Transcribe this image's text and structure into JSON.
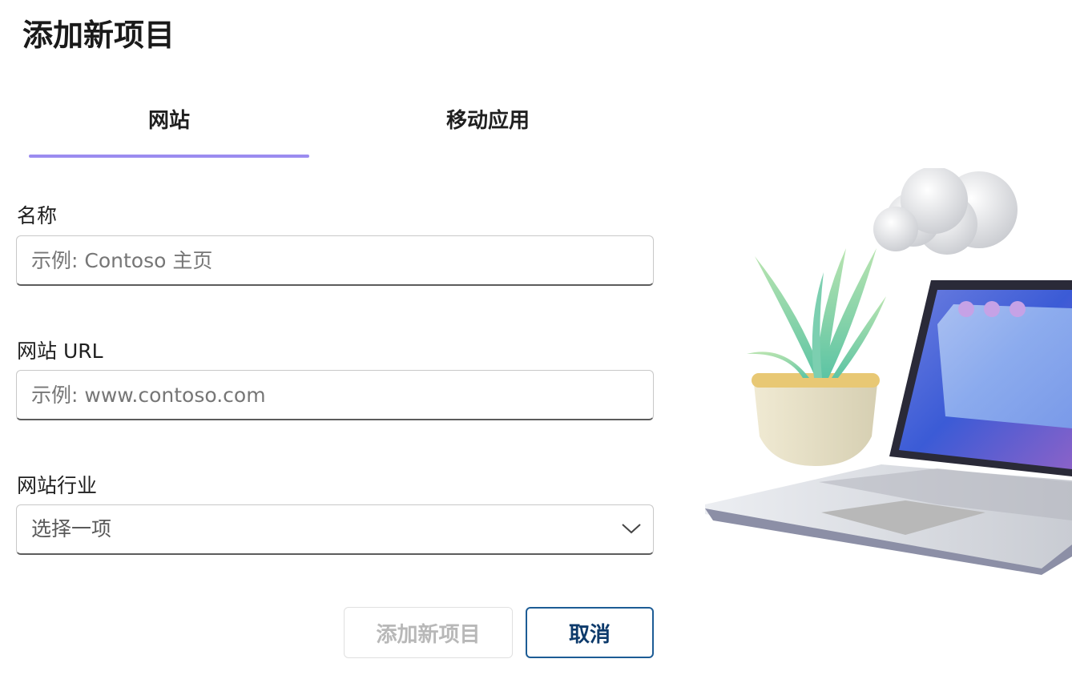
{
  "page": {
    "title": "添加新项目"
  },
  "tabs": [
    {
      "label": "网站",
      "selected": true
    },
    {
      "label": "移动应用",
      "selected": false
    }
  ],
  "form": {
    "name": {
      "label": "名称",
      "placeholder": "示例: Contoso 主页",
      "value": ""
    },
    "url": {
      "label": "网站 URL",
      "placeholder": "示例: www.contoso.com",
      "value": ""
    },
    "industry": {
      "label": "网站行业",
      "selected": "选择一项"
    }
  },
  "buttons": {
    "add_label": "添加新项目",
    "cancel_label": "取消"
  },
  "colors": {
    "tab_accent": "#9b8cf0",
    "cancel_border": "#1d5c95",
    "disabled_text": "#b8b8b8"
  },
  "icons": {
    "select_chevron": "chevron-down-icon"
  }
}
